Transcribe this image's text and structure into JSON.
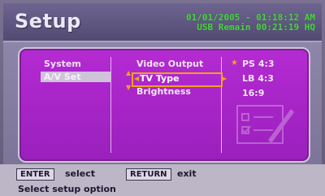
{
  "header": {
    "title": "Setup",
    "date_time": "01/01/2005 - 01:18:12 AM",
    "usb_remain": "USB Remain 00:21:19 HQ"
  },
  "menu": {
    "categories": [
      {
        "label": "System",
        "selected": false
      },
      {
        "label": "A/V Set",
        "selected": true
      }
    ],
    "settings": [
      {
        "label": "Video Output",
        "selected": false
      },
      {
        "label": "TV Type",
        "selected": true
      },
      {
        "label": "Brightness",
        "selected": false
      }
    ],
    "options": [
      {
        "label": "PS 4:3",
        "current": true
      },
      {
        "label": "LB 4:3",
        "current": false
      },
      {
        "label": "16:9",
        "current": false
      }
    ]
  },
  "footer": {
    "enter_key": "ENTER",
    "enter_action": "select",
    "return_key": "RETURN",
    "return_action": "exit",
    "hint": "Select setup option"
  },
  "colors": {
    "panel": "#a624c6",
    "highlight": "#f0a020",
    "status_text": "#4fd04a",
    "header": "#5e577f"
  }
}
